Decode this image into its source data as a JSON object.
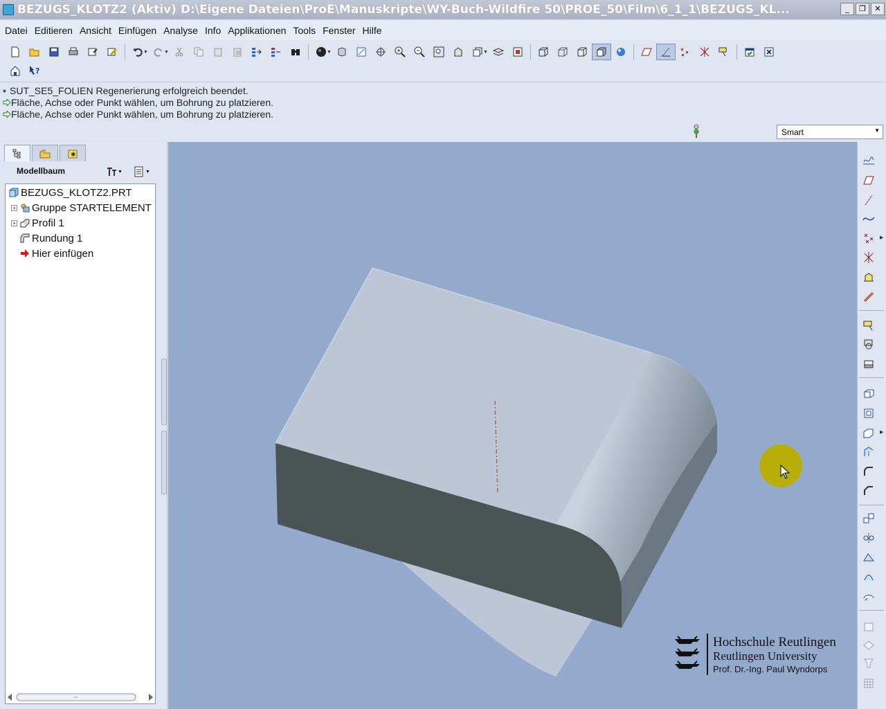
{
  "window": {
    "title": "BEZUGS_KLOTZ2 (Aktiv) D:\\Eigene Dateien\\ProE\\Manuskripte\\WY-Buch-Wildfire 50\\PROE_50\\Film\\6_1_1\\BEZUGS_KL...",
    "minimize": "_",
    "restore": "❐",
    "close": "✕"
  },
  "menubar": {
    "items": [
      "Datei",
      "Editieren",
      "Ansicht",
      "Einfügen",
      "Analyse",
      "Info",
      "Applikationen",
      "Tools",
      "Fenster",
      "Hilfe"
    ]
  },
  "toolbar": {
    "row1_icons": [
      "new-icon",
      "open-icon",
      "save-icon",
      "print-icon",
      "send-icon",
      "edit-icon",
      "undo-icon",
      "redo-icon",
      "cut-icon",
      "copy-icon",
      "paste-icon",
      "paste-special-icon",
      "regenerate-icon",
      "regen-manager-icon",
      "find-icon",
      "shading-icon",
      "view-manager-icon",
      "repaint-icon",
      "spin-center-icon",
      "zoom-in-icon",
      "zoom-out-icon",
      "refit-icon",
      "reorient-icon",
      "saved-views-icon",
      "layers-icon",
      "appearance-icon",
      "wireframe-icon",
      "hidden-line-icon",
      "no-hidden-icon",
      "shaded-icon",
      "enhanced-realism-icon",
      "datum-planes-icon",
      "datum-axes-icon",
      "datum-points-icon",
      "coord-systems-icon",
      "annotations-icon",
      "window-activate-icon",
      "window-close-icon"
    ],
    "row2_icons": [
      "home-icon",
      "context-help-icon"
    ]
  },
  "messages": [
    {
      "type": "info",
      "text": "SUT_SE5_FOLIEN Regenerierung erfolgreich beendet."
    },
    {
      "type": "prompt",
      "text": "Fläche, Achse oder Punkt wählen, um Bohrung zu platzieren."
    },
    {
      "type": "prompt",
      "text": "Fläche, Achse oder Punkt wählen, um Bohrung zu platzieren."
    }
  ],
  "selection_filter": {
    "value": "Smart"
  },
  "model_tree": {
    "title": "Modellbaum",
    "items": [
      {
        "label": "BEZUGS_KLOTZ2.PRT",
        "icon": "part-icon",
        "expander": ""
      },
      {
        "label": "Gruppe STARTELEMENT",
        "icon": "group-icon",
        "expander": "+"
      },
      {
        "label": "Profil 1",
        "icon": "extrude-icon",
        "expander": "+"
      },
      {
        "label": "Rundung 1",
        "icon": "round-icon",
        "expander": ""
      },
      {
        "label": "Hier einfügen",
        "icon": "insert-here-icon",
        "expander": ""
      }
    ]
  },
  "logo": {
    "line1": "Hochschule Reutlingen",
    "line2": "Reutlingen University",
    "line3": "Prof. Dr.-Ing. Paul Wyndorps"
  },
  "right_toolbar": {
    "icons": [
      "sketch-icon",
      "datum-plane-icon",
      "datum-axis-icon",
      "datum-curve-icon",
      "datum-point-icon",
      "datum-csys-icon",
      "datum-analysis-icon",
      "datum-chain-icon",
      "extrude-tool-icon",
      "revolve-tool-icon",
      "variable-section-sweep-icon",
      "hole-tool-icon",
      "shell-tool-icon",
      "rib-tool-icon",
      "draft-tool-icon",
      "round-tool-icon",
      "chamfer-tool-icon",
      "pattern-tool-icon",
      "mirror-tool-icon",
      "merge-tool-icon",
      "trim-tool-icon",
      "offset-tool-icon",
      "style-tool-icon",
      "intersect-tool-icon",
      "solidify-tool-icon",
      "thicken-tool-icon"
    ]
  },
  "colors": {
    "viewport_bg": "#93aacd",
    "top_face": "#bcc6d7",
    "front_face": "#4b5455",
    "cursor_highlight": "#b7ae09"
  }
}
